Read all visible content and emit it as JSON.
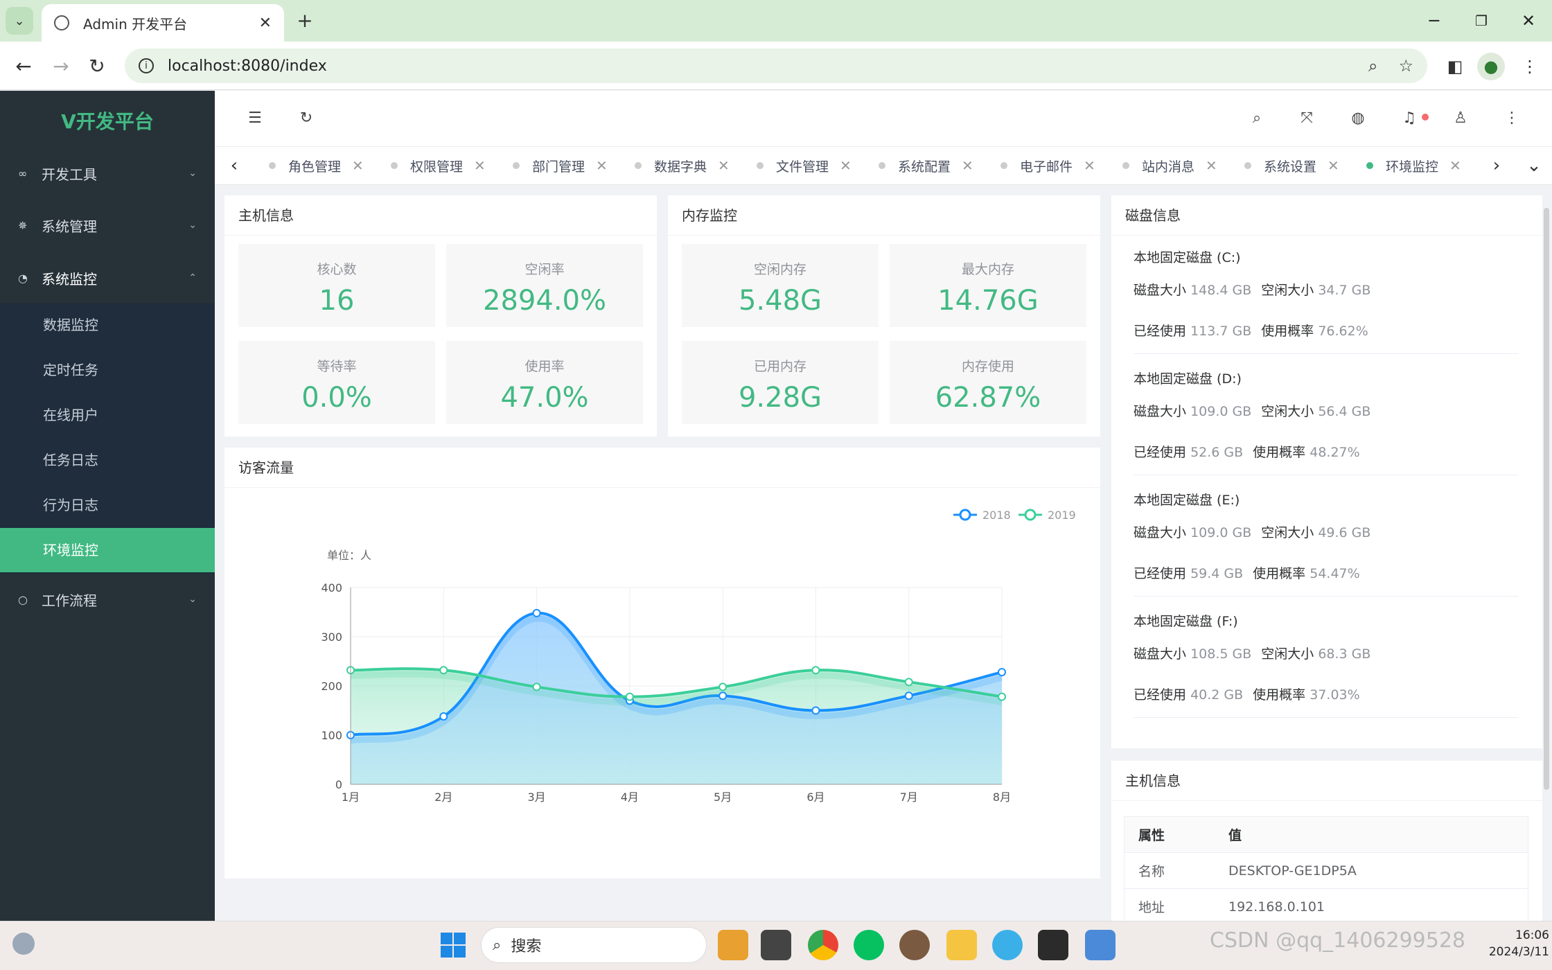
{
  "browser": {
    "tab_title": "Admin 开发平台",
    "url": "localhost:8080/index"
  },
  "sidebar": {
    "logo": "V开发平台",
    "menus": [
      {
        "label": "开发工具",
        "icon": "infinity-icon"
      },
      {
        "label": "系统管理",
        "icon": "gear-icon"
      },
      {
        "label": "系统监控",
        "icon": "dashboard-icon"
      },
      {
        "label": "工作流程",
        "icon": "circle-icon"
      }
    ],
    "submenu": [
      "数据监控",
      "定时任务",
      "在线用户",
      "任务日志",
      "行为日志",
      "环境监控"
    ]
  },
  "tags": [
    "角色管理",
    "权限管理",
    "部门管理",
    "数据字典",
    "文件管理",
    "系统配置",
    "电子邮件",
    "站内消息",
    "系统设置",
    "环境监控"
  ],
  "host_panel": {
    "title": "主机信息",
    "stats": [
      {
        "label": "核心数",
        "value": "16"
      },
      {
        "label": "空闲率",
        "value": "2894.0%"
      },
      {
        "label": "等待率",
        "value": "0.0%"
      },
      {
        "label": "使用率",
        "value": "47.0%"
      }
    ]
  },
  "memory_panel": {
    "title": "内存监控",
    "stats": [
      {
        "label": "空闲内存",
        "value": "5.48G"
      },
      {
        "label": "最大内存",
        "value": "14.76G"
      },
      {
        "label": "已用内存",
        "value": "9.28G"
      },
      {
        "label": "内存使用",
        "value": "62.87%"
      }
    ]
  },
  "visitor_panel": {
    "title": "访客流量"
  },
  "chart_data": {
    "type": "line",
    "title": "",
    "unit_label": "单位：人",
    "categories": [
      "1月",
      "2月",
      "3月",
      "4月",
      "5月",
      "6月",
      "7月",
      "8月"
    ],
    "ylim": [
      0,
      400
    ],
    "yticks": [
      0,
      100,
      200,
      300,
      400
    ],
    "series": [
      {
        "name": "2018",
        "color": "#1890ff",
        "values": [
          100,
          138,
          348,
          170,
          180,
          150,
          180,
          228
        ]
      },
      {
        "name": "2019",
        "color": "#3bcf9a",
        "values": [
          232,
          232,
          198,
          178,
          198,
          232,
          208,
          178
        ]
      }
    ],
    "legend": "top-right",
    "grid": true,
    "smooth": true,
    "area": true
  },
  "disk_panel": {
    "title": "磁盘信息",
    "size_label": "磁盘大小",
    "free_label": "空闲大小",
    "used_label": "已经使用",
    "rate_label": "使用概率",
    "disks": [
      {
        "name": "本地固定磁盘 (C:)",
        "size": "148.4 GB",
        "free": "34.7 GB",
        "used": "113.7 GB",
        "rate": "76.62%"
      },
      {
        "name": "本地固定磁盘 (D:)",
        "size": "109.0 GB",
        "free": "56.4 GB",
        "used": "52.6 GB",
        "rate": "48.27%"
      },
      {
        "name": "本地固定磁盘 (E:)",
        "size": "109.0 GB",
        "free": "49.6 GB",
        "used": "59.4 GB",
        "rate": "54.47%"
      },
      {
        "name": "本地固定磁盘 (F:)",
        "size": "108.5 GB",
        "free": "68.3 GB",
        "used": "40.2 GB",
        "rate": "37.03%"
      }
    ]
  },
  "host_info_panel": {
    "title": "主机信息",
    "headers": [
      "属性",
      "值"
    ],
    "rows": [
      [
        "名称",
        "DESKTOP-GE1DP5A"
      ],
      [
        "地址",
        "192.168.0.101"
      ]
    ]
  },
  "taskbar": {
    "search": "搜索",
    "time": "16:06",
    "date": "2024/3/11",
    "watermark": "CSDN @qq_1406299528"
  }
}
